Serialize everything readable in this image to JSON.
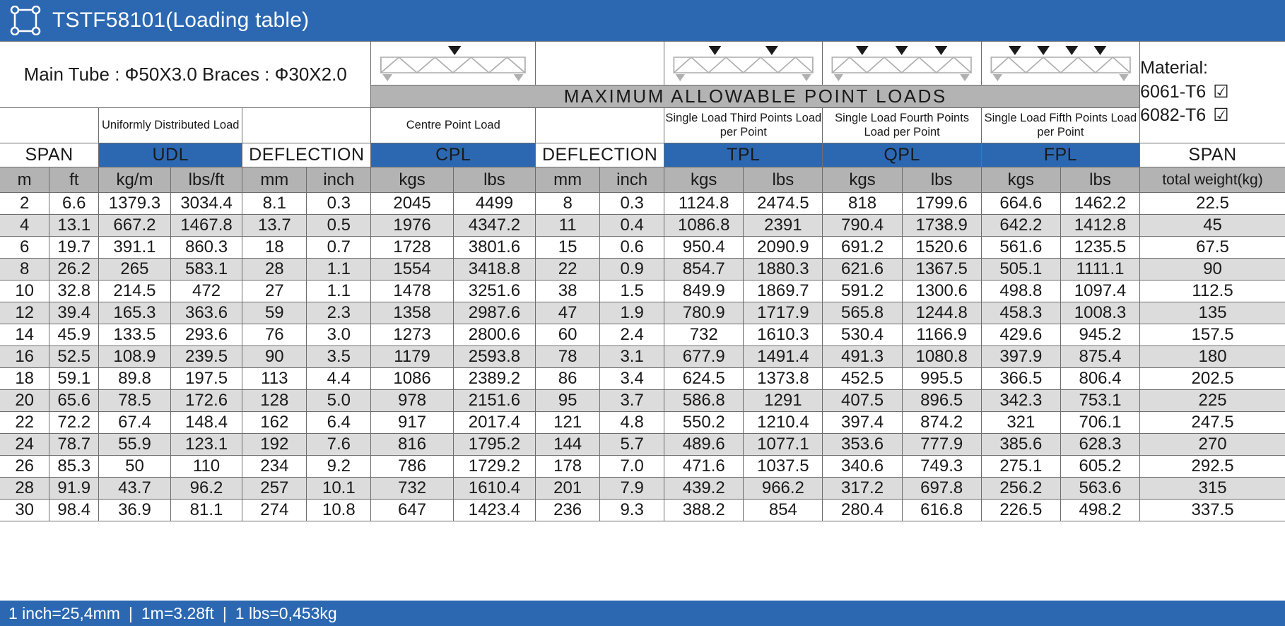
{
  "titlebar": {
    "icon": "frame-corners-icon",
    "title": "TSTF58101(Loading table)"
  },
  "spec": {
    "text": "Main Tube : Ф50X3.0   Braces : Ф30X2.0"
  },
  "banner": {
    "text": "MAXIMUM ALLOWABLE POINT LOADS"
  },
  "material": {
    "label": "Material:",
    "option1": "6061-T6",
    "option1_checked": "☑",
    "option2": "6082-T6",
    "option2_checked": "☑"
  },
  "headers": {
    "span_left": "SPAN",
    "udl_desc": "Uniformly Distributed Load",
    "udl": "UDL",
    "deflection1": "DEFLECTION",
    "cpl_desc": "Centre Point Load",
    "cpl": "CPL",
    "deflection2": "DEFLECTION",
    "tpl_desc": "Single Load Third Points Load per Point",
    "tpl": "TPL",
    "qpl_desc": "Single Load Fourth Points Load per Point",
    "qpl": "QPL",
    "fpl_desc": "Single Load Fifth Points Load per Point",
    "fpl": "FPL",
    "span_right": "SPAN"
  },
  "units": {
    "m": "m",
    "ft": "ft",
    "udl_kgm": "kg/m",
    "udl_lbsft": "lbs/ft",
    "def1_mm": "mm",
    "def1_inch": "inch",
    "cpl_kgs": "kgs",
    "cpl_lbs": "lbs",
    "def2_mm": "mm",
    "def2_inch": "inch",
    "tpl_kgs": "kgs",
    "tpl_lbs": "lbs",
    "qpl_kgs": "kgs",
    "qpl_lbs": "lbs",
    "fpl_kgs": "kgs",
    "fpl_lbs": "lbs",
    "total_weight": "total weight(kg)"
  },
  "footer": {
    "item1": "1 inch=25,4mm",
    "sep1": "|",
    "item2": "1m=3.28ft",
    "sep2": "|",
    "item3": "1 lbs=0,453kg"
  },
  "colors": {
    "brand_blue": "#2c68b2",
    "banner_gray": "#b3b3b3",
    "row_alt_gray": "#dcdcdc",
    "border": "#6d6d6d"
  },
  "chart_data": {
    "type": "table",
    "title": "TSTF58101(Loading table)",
    "columns": [
      "m",
      "ft",
      "kg/m",
      "lbs/ft",
      "mm",
      "inch",
      "kgs",
      "lbs",
      "mm",
      "inch",
      "kgs",
      "lbs",
      "kgs",
      "lbs",
      "kgs",
      "lbs",
      "total weight(kg)"
    ],
    "column_groups": [
      "SPAN",
      "UDL",
      "DEFLECTION",
      "CPL",
      "DEFLECTION",
      "TPL",
      "QPL",
      "FPL",
      "SPAN"
    ],
    "rows": [
      [
        "2",
        "6.6",
        "1379.3",
        "3034.4",
        "8.1",
        "0.3",
        "2045",
        "4499",
        "8",
        "0.3",
        "1124.8",
        "2474.5",
        "818",
        "1799.6",
        "664.6",
        "1462.2",
        "22.5"
      ],
      [
        "4",
        "13.1",
        "667.2",
        "1467.8",
        "13.7",
        "0.5",
        "1976",
        "4347.2",
        "11",
        "0.4",
        "1086.8",
        "2391",
        "790.4",
        "1738.9",
        "642.2",
        "1412.8",
        "45"
      ],
      [
        "6",
        "19.7",
        "391.1",
        "860.3",
        "18",
        "0.7",
        "1728",
        "3801.6",
        "15",
        "0.6",
        "950.4",
        "2090.9",
        "691.2",
        "1520.6",
        "561.6",
        "1235.5",
        "67.5"
      ],
      [
        "8",
        "26.2",
        "265",
        "583.1",
        "28",
        "1.1",
        "1554",
        "3418.8",
        "22",
        "0.9",
        "854.7",
        "1880.3",
        "621.6",
        "1367.5",
        "505.1",
        "1111.1",
        "90"
      ],
      [
        "10",
        "32.8",
        "214.5",
        "472",
        "27",
        "1.1",
        "1478",
        "3251.6",
        "38",
        "1.5",
        "849.9",
        "1869.7",
        "591.2",
        "1300.6",
        "498.8",
        "1097.4",
        "112.5"
      ],
      [
        "12",
        "39.4",
        "165.3",
        "363.6",
        "59",
        "2.3",
        "1358",
        "2987.6",
        "47",
        "1.9",
        "780.9",
        "1717.9",
        "565.8",
        "1244.8",
        "458.3",
        "1008.3",
        "135"
      ],
      [
        "14",
        "45.9",
        "133.5",
        "293.6",
        "76",
        "3.0",
        "1273",
        "2800.6",
        "60",
        "2.4",
        "732",
        "1610.3",
        "530.4",
        "1166.9",
        "429.6",
        "945.2",
        "157.5"
      ],
      [
        "16",
        "52.5",
        "108.9",
        "239.5",
        "90",
        "3.5",
        "1179",
        "2593.8",
        "78",
        "3.1",
        "677.9",
        "1491.4",
        "491.3",
        "1080.8",
        "397.9",
        "875.4",
        "180"
      ],
      [
        "18",
        "59.1",
        "89.8",
        "197.5",
        "113",
        "4.4",
        "1086",
        "2389.2",
        "86",
        "3.4",
        "624.5",
        "1373.8",
        "452.5",
        "995.5",
        "366.5",
        "806.4",
        "202.5"
      ],
      [
        "20",
        "65.6",
        "78.5",
        "172.6",
        "128",
        "5.0",
        "978",
        "2151.6",
        "95",
        "3.7",
        "586.8",
        "1291",
        "407.5",
        "896.5",
        "342.3",
        "753.1",
        "225"
      ],
      [
        "22",
        "72.2",
        "67.4",
        "148.4",
        "162",
        "6.4",
        "917",
        "2017.4",
        "121",
        "4.8",
        "550.2",
        "1210.4",
        "397.4",
        "874.2",
        "321",
        "706.1",
        "247.5"
      ],
      [
        "24",
        "78.7",
        "55.9",
        "123.1",
        "192",
        "7.6",
        "816",
        "1795.2",
        "144",
        "5.7",
        "489.6",
        "1077.1",
        "353.6",
        "777.9",
        "385.6",
        "628.3",
        "270"
      ],
      [
        "26",
        "85.3",
        "50",
        "110",
        "234",
        "9.2",
        "786",
        "1729.2",
        "178",
        "7.0",
        "471.6",
        "1037.5",
        "340.6",
        "749.3",
        "275.1",
        "605.2",
        "292.5"
      ],
      [
        "28",
        "91.9",
        "43.7",
        "96.2",
        "257",
        "10.1",
        "732",
        "1610.4",
        "201",
        "7.9",
        "439.2",
        "966.2",
        "317.2",
        "697.8",
        "256.2",
        "563.6",
        "315"
      ],
      [
        "30",
        "98.4",
        "36.9",
        "81.1",
        "274",
        "10.8",
        "647",
        "1423.4",
        "236",
        "9.3",
        "388.2",
        "854",
        "280.4",
        "616.8",
        "226.5",
        "498.2",
        "337.5"
      ]
    ]
  }
}
